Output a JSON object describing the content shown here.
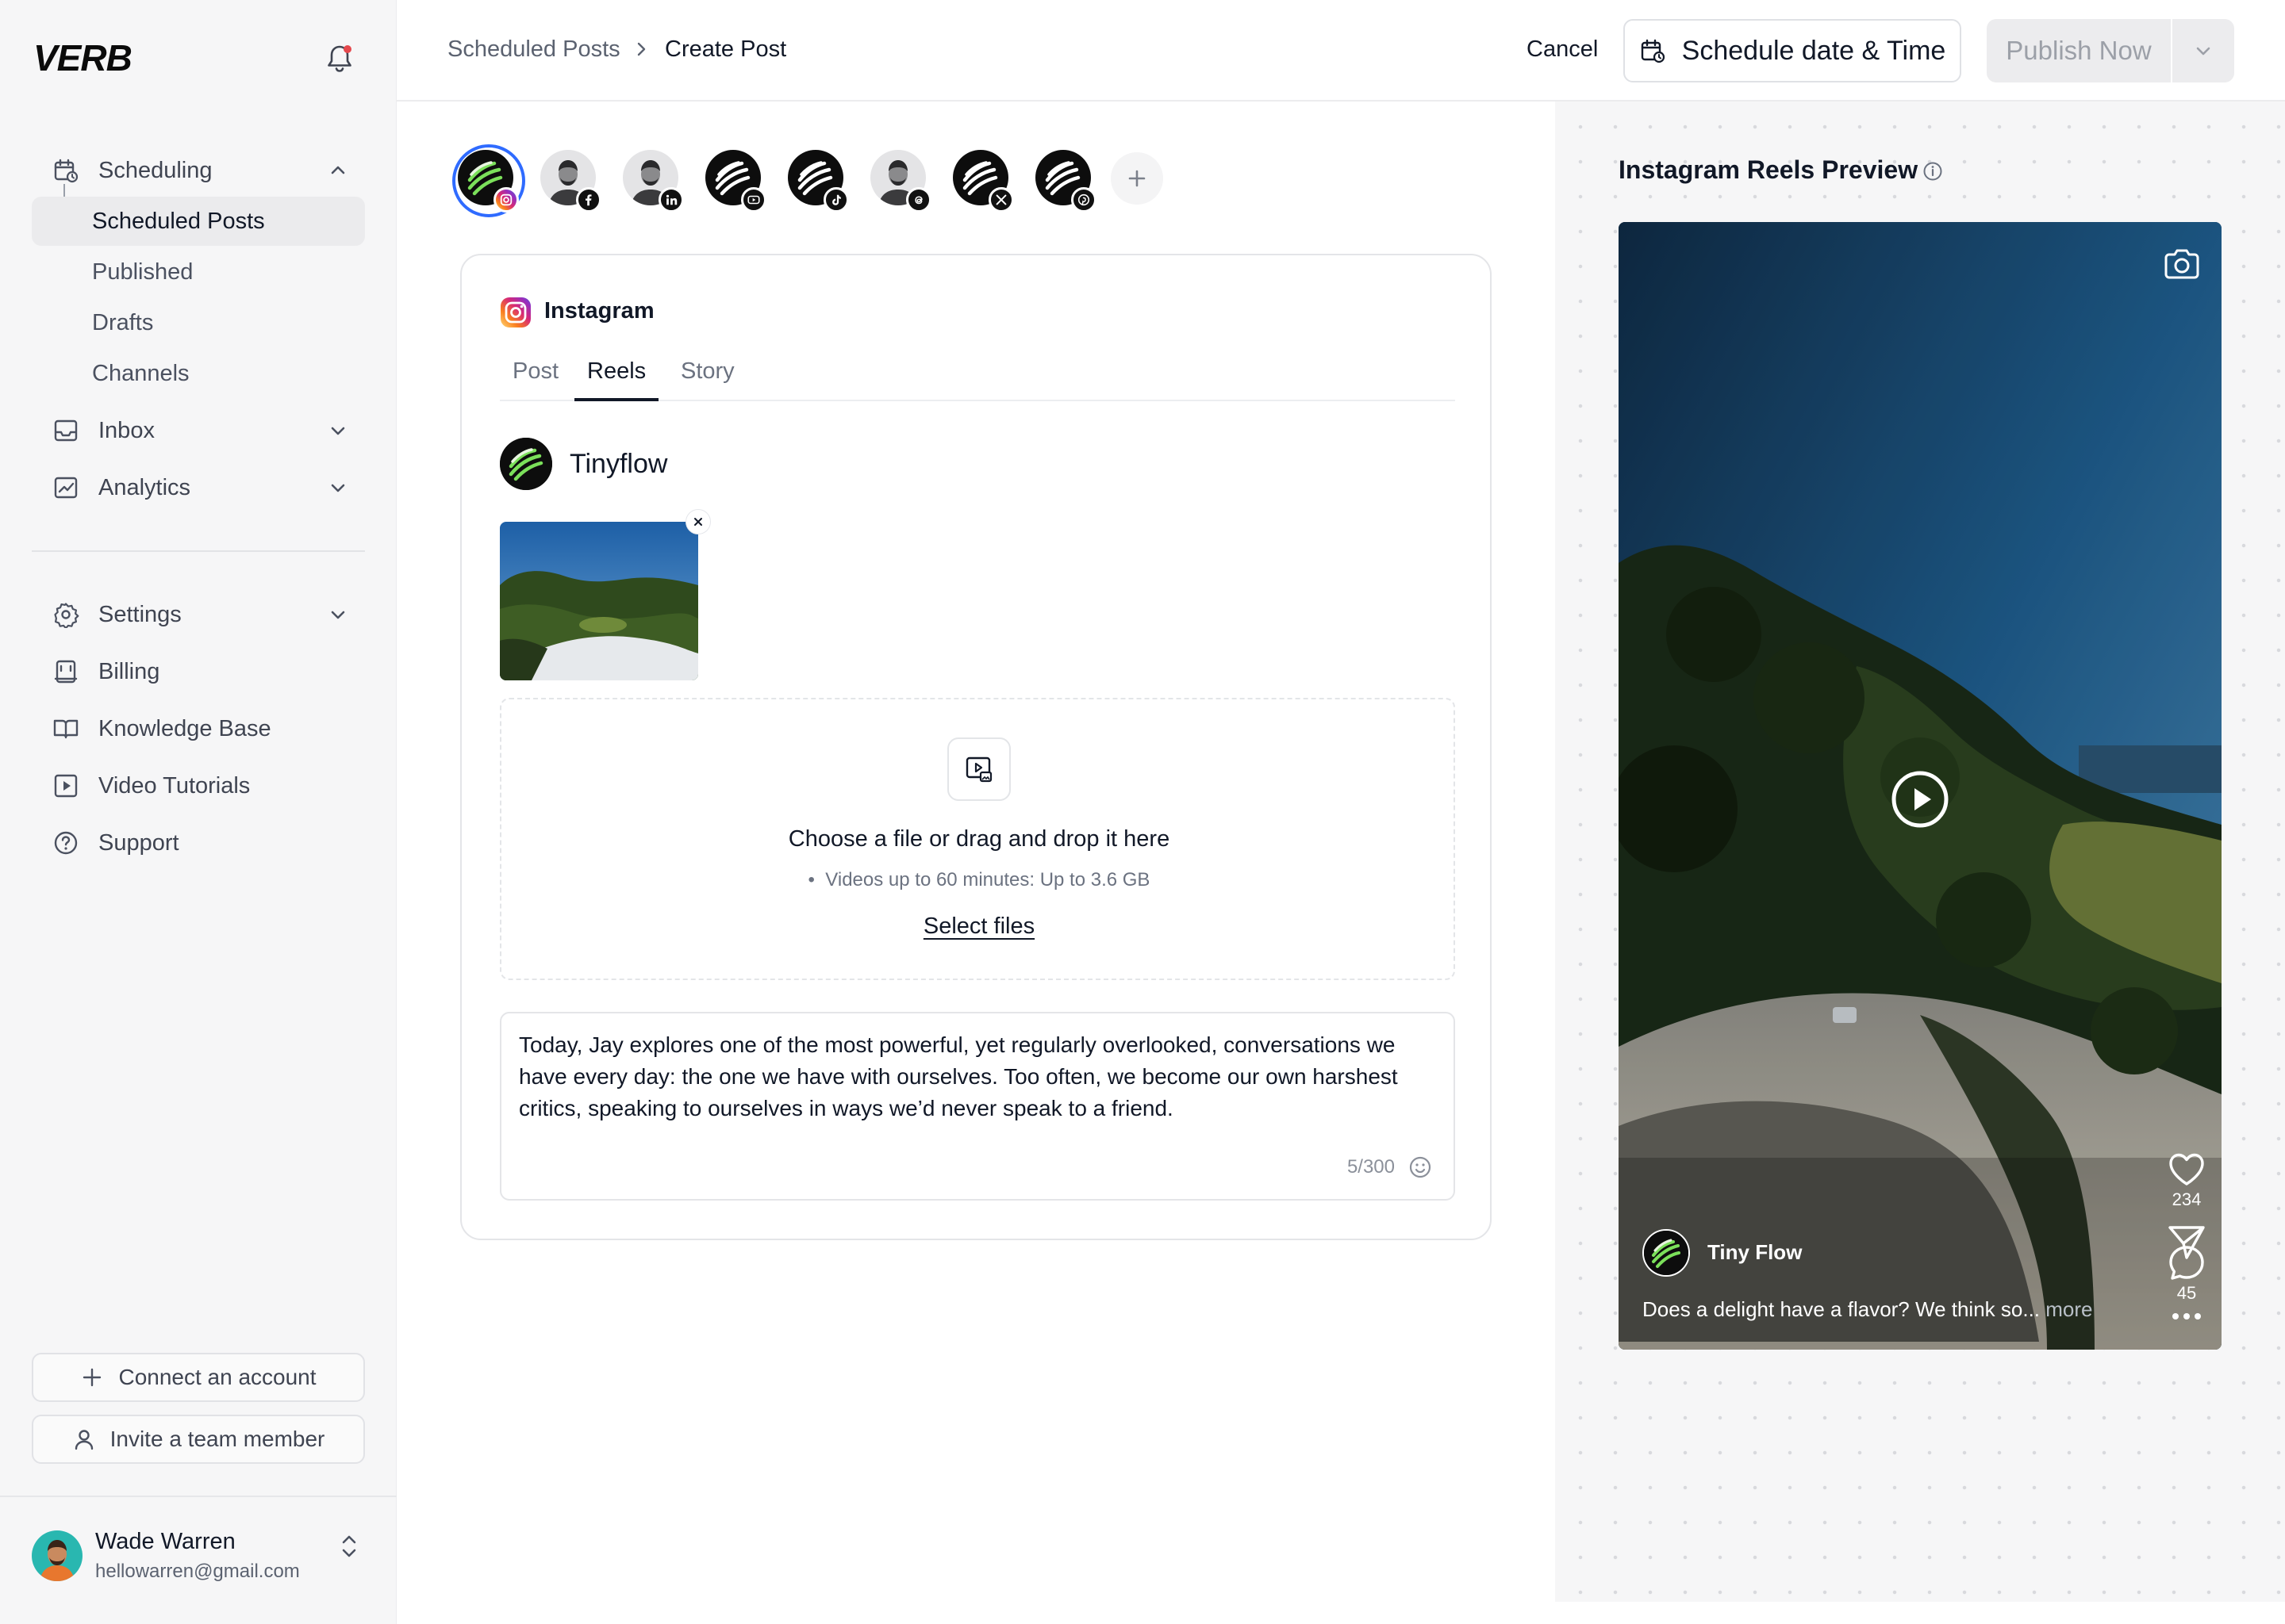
{
  "app": {
    "logo": "VERB"
  },
  "sidebar": {
    "scheduling": "Scheduling",
    "scheduling_items": [
      "Scheduled Posts",
      "Published",
      "Drafts",
      "Channels"
    ],
    "inbox": "Inbox",
    "analytics": "Analytics",
    "settings": "Settings",
    "billing": "Billing",
    "knowledge_base": "Knowledge Base",
    "video_tutorials": "Video Tutorials",
    "support": "Support",
    "connect_account": "Connect an account",
    "invite_member": "Invite a team member"
  },
  "user": {
    "name": "Wade Warren",
    "email": "hellowarren@gmail.com"
  },
  "header": {
    "breadcrumb_parent": "Scheduled Posts",
    "breadcrumb_current": "Create Post",
    "cancel": "Cancel",
    "schedule": "Schedule date & Time",
    "publish": "Publish Now"
  },
  "accounts": [
    {
      "network": "instagram-icon",
      "kind": "brand",
      "selected": true
    },
    {
      "network": "facebook-icon",
      "kind": "person",
      "selected": false
    },
    {
      "network": "linkedin-icon",
      "kind": "person",
      "selected": false
    },
    {
      "network": "youtube-icon",
      "kind": "brand",
      "selected": false
    },
    {
      "network": "tiktok-icon",
      "kind": "brand",
      "selected": false
    },
    {
      "network": "threads-icon",
      "kind": "person",
      "selected": false
    },
    {
      "network": "x-icon",
      "kind": "brand",
      "selected": false
    },
    {
      "network": "pinterest-icon",
      "kind": "brand",
      "selected": false
    }
  ],
  "composer": {
    "platform": "Instagram",
    "tabs": [
      "Post",
      "Reels",
      "Story"
    ],
    "active_tab": "Reels",
    "brand": "Tinyflow",
    "dropzone": {
      "title": "Choose a file or drag and drop it here",
      "note": "Videos up to 60 minutes: Up to 3.6 GB",
      "link": "Select files"
    },
    "caption": "Today, Jay explores one of the most powerful, yet regularly overlooked, conversations we have every day: the one we have with ourselves. Too often, we become our own harshest critics, speaking to ourselves in ways we’d never speak to a friend.",
    "char_count": "5/300"
  },
  "preview": {
    "title": "Instagram Reels Preview",
    "likes": "234",
    "comments": "45",
    "username": "Tiny Flow",
    "caption": "Does a delight have a flavor? We think so...",
    "more": "more"
  },
  "colors": {
    "accent_selected_ring": "#2f6bff",
    "instagram_gradient": [
      "#feda75",
      "#fa7e1e",
      "#d62976",
      "#962fbf",
      "#4f5bd5"
    ],
    "brand_green": "#7be05a"
  }
}
